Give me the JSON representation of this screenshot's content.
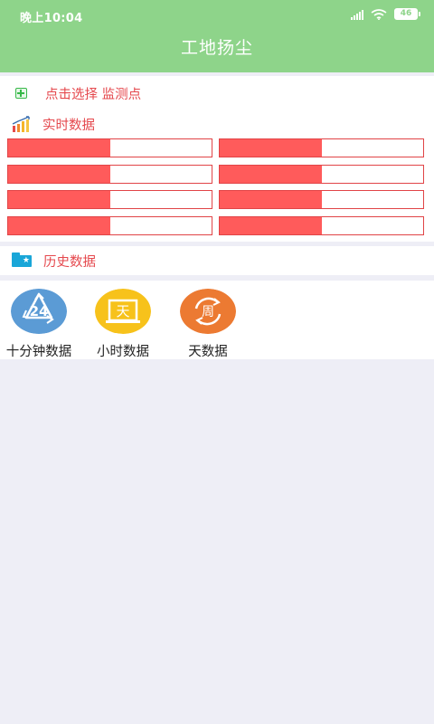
{
  "status_bar": {
    "time": "晚上10:04",
    "battery": "46"
  },
  "header": {
    "title": "工地扬尘"
  },
  "monitor": {
    "select_label": "点击选择 监测点",
    "realtime_label": "实时数据",
    "cells": [
      {
        "fill": 0.5
      },
      {
        "fill": 0.5
      },
      {
        "fill": 0.5
      },
      {
        "fill": 0.5
      },
      {
        "fill": 0.5
      },
      {
        "fill": 0.5
      },
      {
        "fill": 0.5
      },
      {
        "fill": 0.5
      }
    ]
  },
  "history": {
    "label": "历史数据"
  },
  "data_options": [
    {
      "label": "十分钟数据",
      "icon_text": "24",
      "color": "#5b9bd5"
    },
    {
      "label": "小时数据",
      "icon_text": "天",
      "color": "#f7c21b"
    },
    {
      "label": "天数据",
      "icon_text": "周",
      "color": "#ec7a32"
    }
  ],
  "colors": {
    "header_bg": "#8ed48a",
    "accent_red": "#e5484d",
    "cell_fill": "#ff5b5b",
    "history_icon": "#19a6d8"
  }
}
